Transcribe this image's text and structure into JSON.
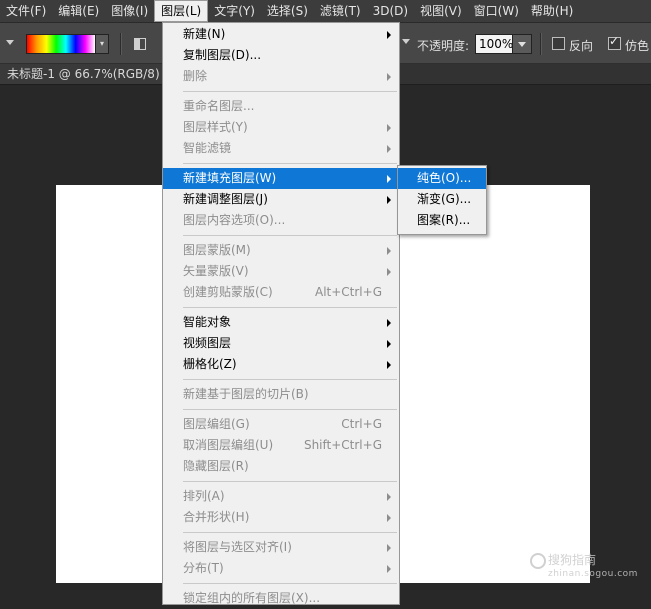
{
  "menubar": {
    "items": [
      "文件(F)",
      "编辑(E)",
      "图像(I)",
      "图层(L)",
      "文字(Y)",
      "选择(S)",
      "滤镜(T)",
      "3D(D)",
      "视图(V)",
      "窗口(W)",
      "帮助(H)"
    ],
    "active_index": 3
  },
  "options": {
    "opacity_label": "不透明度:",
    "opacity_value": "100%",
    "reverse_label": "反向",
    "dither_label": "仿色"
  },
  "document": {
    "tab_title": "未标题-1 @ 66.7%(RGB/8)"
  },
  "layer_menu": {
    "items": [
      {
        "label": "新建(N)",
        "submenu": true,
        "enabled": true
      },
      {
        "label": "复制图层(D)...",
        "enabled": true
      },
      {
        "label": "删除",
        "submenu": true,
        "enabled": false
      },
      {
        "divider": true
      },
      {
        "label": "重命名图层...",
        "enabled": false
      },
      {
        "label": "图层样式(Y)",
        "submenu": true,
        "enabled": false
      },
      {
        "label": "智能滤镜",
        "submenu": true,
        "enabled": false
      },
      {
        "divider": true
      },
      {
        "label": "新建填充图层(W)",
        "submenu": true,
        "enabled": true,
        "highlight": true
      },
      {
        "label": "新建调整图层(J)",
        "submenu": true,
        "enabled": true
      },
      {
        "label": "图层内容选项(O)...",
        "enabled": false
      },
      {
        "divider": true
      },
      {
        "label": "图层蒙版(M)",
        "submenu": true,
        "enabled": false
      },
      {
        "label": "矢量蒙版(V)",
        "submenu": true,
        "enabled": false
      },
      {
        "label": "创建剪贴蒙版(C)",
        "shortcut": "Alt+Ctrl+G",
        "enabled": false
      },
      {
        "divider": true
      },
      {
        "label": "智能对象",
        "submenu": true,
        "enabled": true
      },
      {
        "label": "视频图层",
        "submenu": true,
        "enabled": true
      },
      {
        "label": "栅格化(Z)",
        "submenu": true,
        "enabled": true
      },
      {
        "divider": true
      },
      {
        "label": "新建基于图层的切片(B)",
        "enabled": false
      },
      {
        "divider": true
      },
      {
        "label": "图层编组(G)",
        "shortcut": "Ctrl+G",
        "enabled": false
      },
      {
        "label": "取消图层编组(U)",
        "shortcut": "Shift+Ctrl+G",
        "enabled": false
      },
      {
        "label": "隐藏图层(R)",
        "enabled": false
      },
      {
        "divider": true
      },
      {
        "label": "排列(A)",
        "submenu": true,
        "enabled": false
      },
      {
        "label": "合并形状(H)",
        "submenu": true,
        "enabled": false
      },
      {
        "divider": true
      },
      {
        "label": "将图层与选区对齐(I)",
        "submenu": true,
        "enabled": false
      },
      {
        "label": "分布(T)",
        "submenu": true,
        "enabled": false
      },
      {
        "divider": true
      },
      {
        "label": "锁定组内的所有图层(X)...",
        "enabled": false
      }
    ]
  },
  "fill_submenu": {
    "items": [
      {
        "label": "纯色(O)...",
        "highlight": true
      },
      {
        "label": "渐变(G)..."
      },
      {
        "label": "图案(R)..."
      }
    ]
  },
  "watermark": {
    "text": "搜狗指南",
    "sub": "zhinan.sogou.com"
  },
  "colors": {
    "highlight": "#0f78d7",
    "menu_bg": "#f0f0f0",
    "app_bg": "#282828"
  }
}
